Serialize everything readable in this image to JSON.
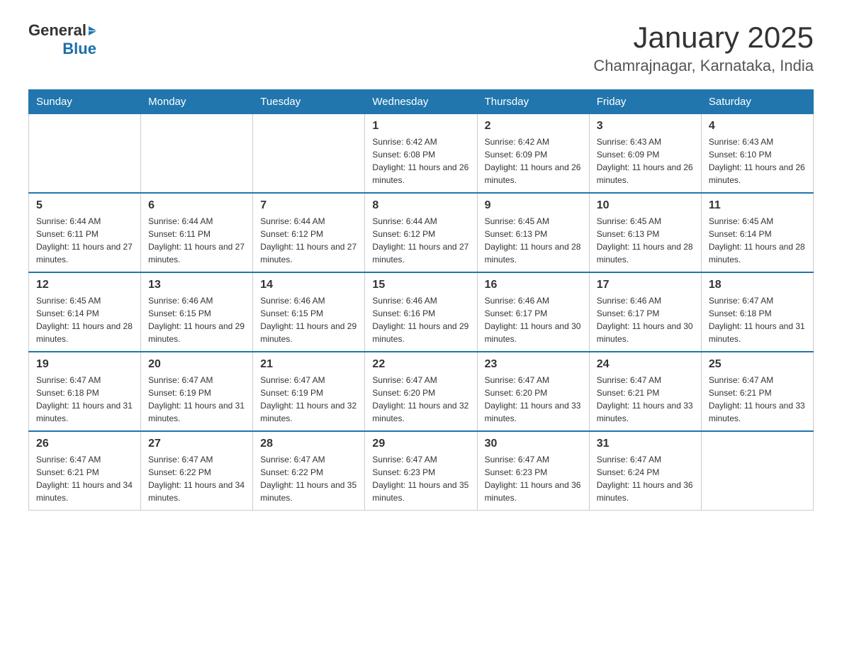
{
  "header": {
    "logo_general": "General",
    "logo_blue": "Blue",
    "month_title": "January 2025",
    "location": "Chamrajnagar, Karnataka, India"
  },
  "days_of_week": [
    "Sunday",
    "Monday",
    "Tuesday",
    "Wednesday",
    "Thursday",
    "Friday",
    "Saturday"
  ],
  "weeks": [
    [
      {
        "day": "",
        "info": ""
      },
      {
        "day": "",
        "info": ""
      },
      {
        "day": "",
        "info": ""
      },
      {
        "day": "1",
        "info": "Sunrise: 6:42 AM\nSunset: 6:08 PM\nDaylight: 11 hours and 26 minutes."
      },
      {
        "day": "2",
        "info": "Sunrise: 6:42 AM\nSunset: 6:09 PM\nDaylight: 11 hours and 26 minutes."
      },
      {
        "day": "3",
        "info": "Sunrise: 6:43 AM\nSunset: 6:09 PM\nDaylight: 11 hours and 26 minutes."
      },
      {
        "day": "4",
        "info": "Sunrise: 6:43 AM\nSunset: 6:10 PM\nDaylight: 11 hours and 26 minutes."
      }
    ],
    [
      {
        "day": "5",
        "info": "Sunrise: 6:44 AM\nSunset: 6:11 PM\nDaylight: 11 hours and 27 minutes."
      },
      {
        "day": "6",
        "info": "Sunrise: 6:44 AM\nSunset: 6:11 PM\nDaylight: 11 hours and 27 minutes."
      },
      {
        "day": "7",
        "info": "Sunrise: 6:44 AM\nSunset: 6:12 PM\nDaylight: 11 hours and 27 minutes."
      },
      {
        "day": "8",
        "info": "Sunrise: 6:44 AM\nSunset: 6:12 PM\nDaylight: 11 hours and 27 minutes."
      },
      {
        "day": "9",
        "info": "Sunrise: 6:45 AM\nSunset: 6:13 PM\nDaylight: 11 hours and 28 minutes."
      },
      {
        "day": "10",
        "info": "Sunrise: 6:45 AM\nSunset: 6:13 PM\nDaylight: 11 hours and 28 minutes."
      },
      {
        "day": "11",
        "info": "Sunrise: 6:45 AM\nSunset: 6:14 PM\nDaylight: 11 hours and 28 minutes."
      }
    ],
    [
      {
        "day": "12",
        "info": "Sunrise: 6:45 AM\nSunset: 6:14 PM\nDaylight: 11 hours and 28 minutes."
      },
      {
        "day": "13",
        "info": "Sunrise: 6:46 AM\nSunset: 6:15 PM\nDaylight: 11 hours and 29 minutes."
      },
      {
        "day": "14",
        "info": "Sunrise: 6:46 AM\nSunset: 6:15 PM\nDaylight: 11 hours and 29 minutes."
      },
      {
        "day": "15",
        "info": "Sunrise: 6:46 AM\nSunset: 6:16 PM\nDaylight: 11 hours and 29 minutes."
      },
      {
        "day": "16",
        "info": "Sunrise: 6:46 AM\nSunset: 6:17 PM\nDaylight: 11 hours and 30 minutes."
      },
      {
        "day": "17",
        "info": "Sunrise: 6:46 AM\nSunset: 6:17 PM\nDaylight: 11 hours and 30 minutes."
      },
      {
        "day": "18",
        "info": "Sunrise: 6:47 AM\nSunset: 6:18 PM\nDaylight: 11 hours and 31 minutes."
      }
    ],
    [
      {
        "day": "19",
        "info": "Sunrise: 6:47 AM\nSunset: 6:18 PM\nDaylight: 11 hours and 31 minutes."
      },
      {
        "day": "20",
        "info": "Sunrise: 6:47 AM\nSunset: 6:19 PM\nDaylight: 11 hours and 31 minutes."
      },
      {
        "day": "21",
        "info": "Sunrise: 6:47 AM\nSunset: 6:19 PM\nDaylight: 11 hours and 32 minutes."
      },
      {
        "day": "22",
        "info": "Sunrise: 6:47 AM\nSunset: 6:20 PM\nDaylight: 11 hours and 32 minutes."
      },
      {
        "day": "23",
        "info": "Sunrise: 6:47 AM\nSunset: 6:20 PM\nDaylight: 11 hours and 33 minutes."
      },
      {
        "day": "24",
        "info": "Sunrise: 6:47 AM\nSunset: 6:21 PM\nDaylight: 11 hours and 33 minutes."
      },
      {
        "day": "25",
        "info": "Sunrise: 6:47 AM\nSunset: 6:21 PM\nDaylight: 11 hours and 33 minutes."
      }
    ],
    [
      {
        "day": "26",
        "info": "Sunrise: 6:47 AM\nSunset: 6:21 PM\nDaylight: 11 hours and 34 minutes."
      },
      {
        "day": "27",
        "info": "Sunrise: 6:47 AM\nSunset: 6:22 PM\nDaylight: 11 hours and 34 minutes."
      },
      {
        "day": "28",
        "info": "Sunrise: 6:47 AM\nSunset: 6:22 PM\nDaylight: 11 hours and 35 minutes."
      },
      {
        "day": "29",
        "info": "Sunrise: 6:47 AM\nSunset: 6:23 PM\nDaylight: 11 hours and 35 minutes."
      },
      {
        "day": "30",
        "info": "Sunrise: 6:47 AM\nSunset: 6:23 PM\nDaylight: 11 hours and 36 minutes."
      },
      {
        "day": "31",
        "info": "Sunrise: 6:47 AM\nSunset: 6:24 PM\nDaylight: 11 hours and 36 minutes."
      },
      {
        "day": "",
        "info": ""
      }
    ]
  ]
}
